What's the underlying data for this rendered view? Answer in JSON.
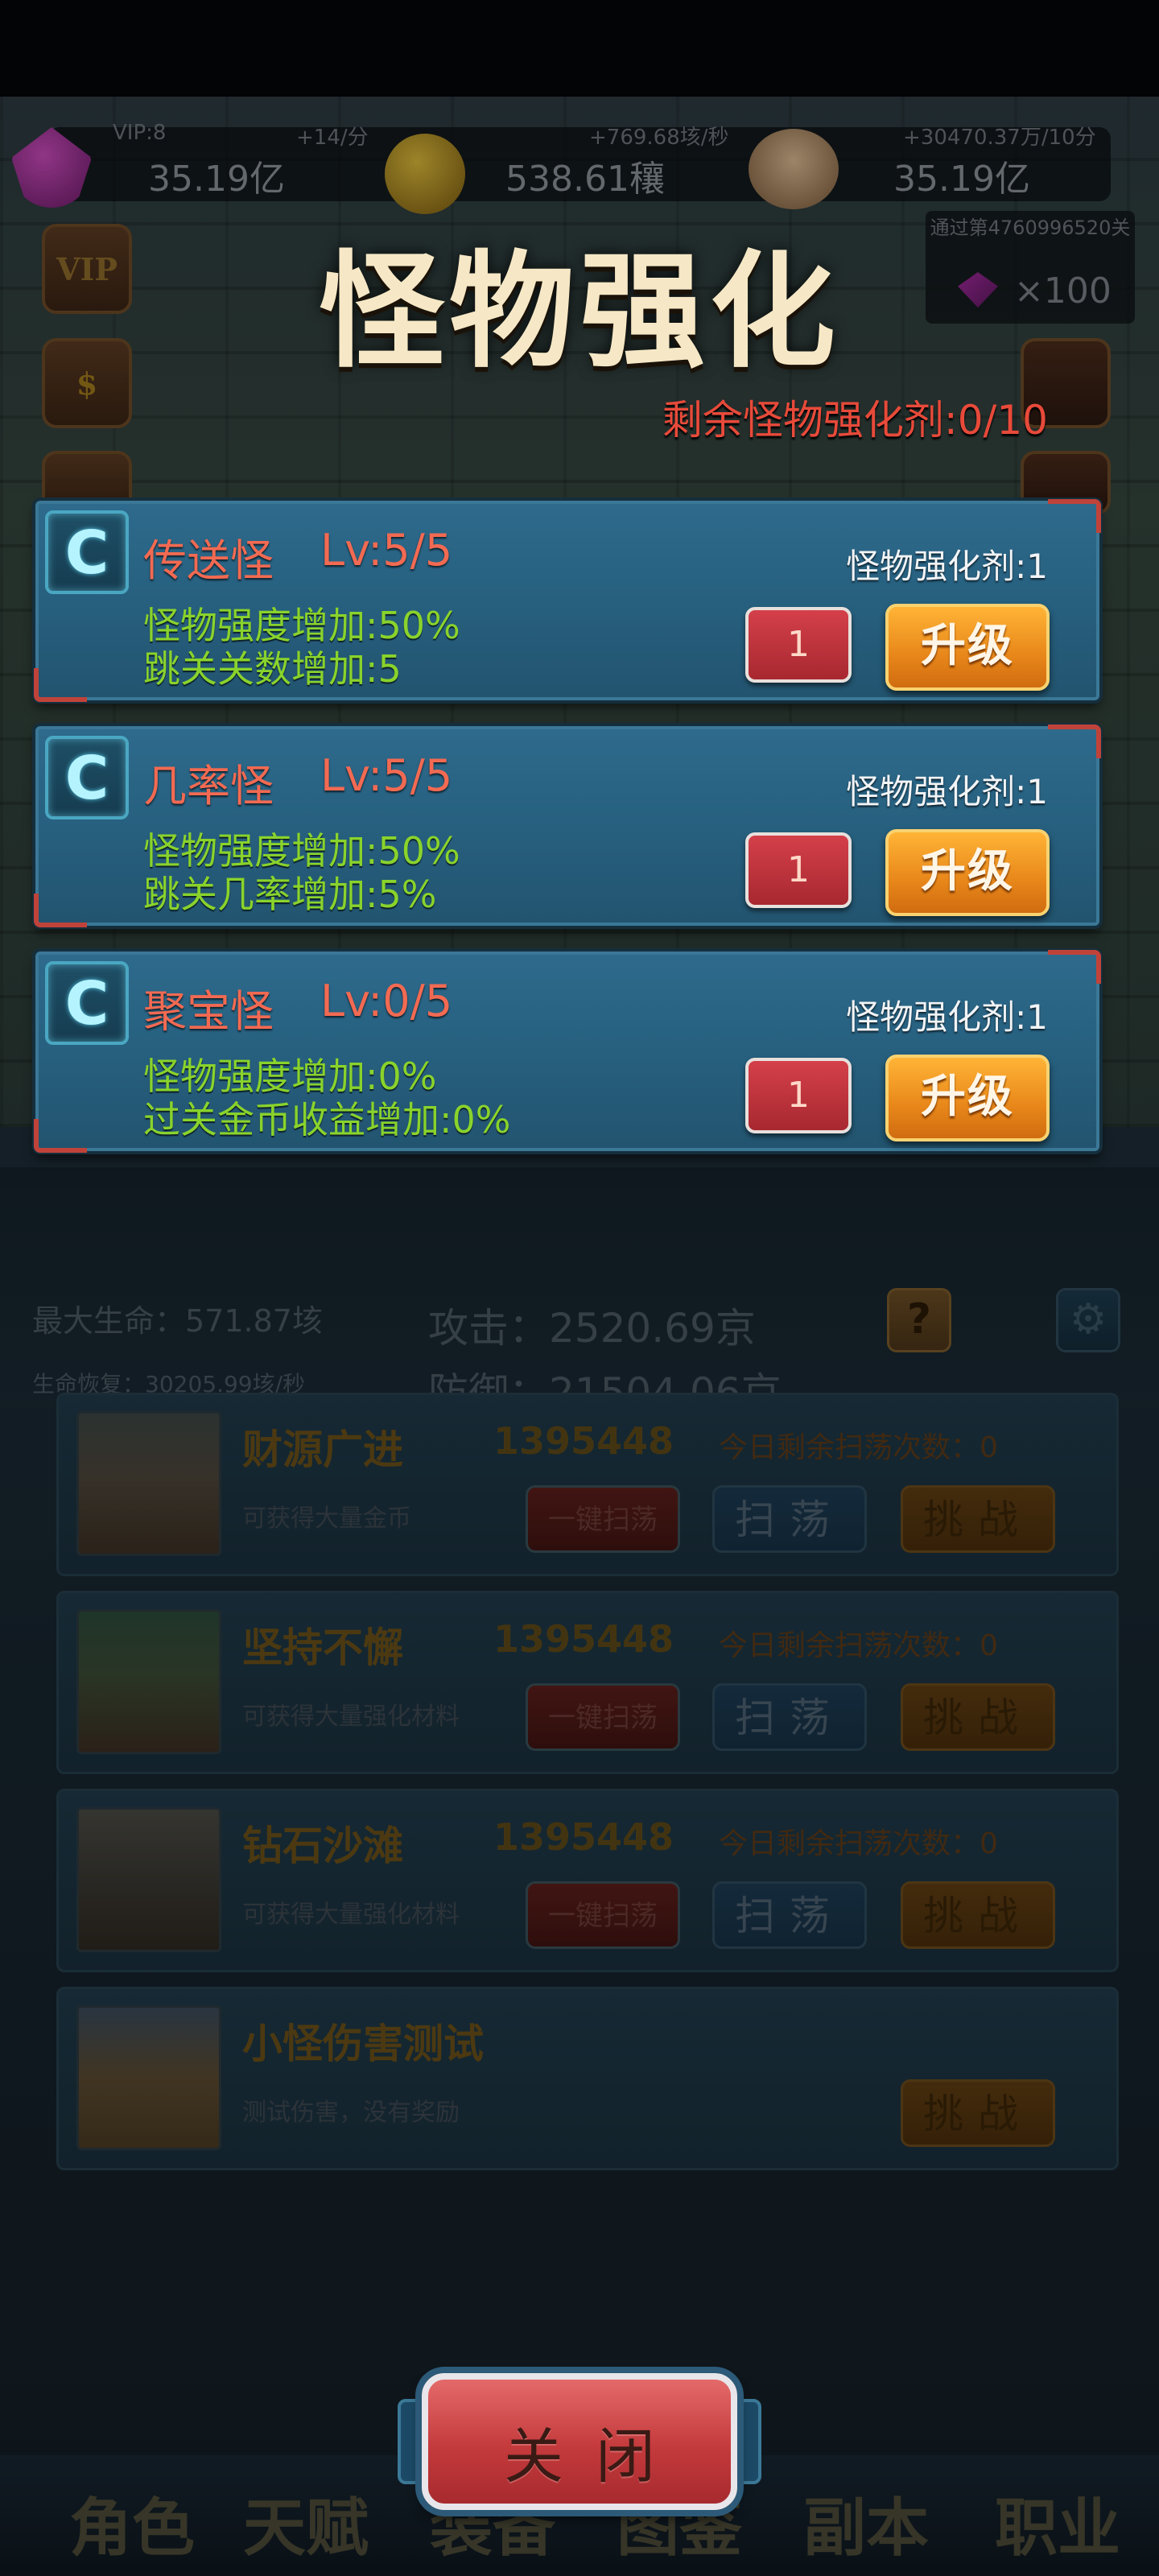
{
  "header": {
    "vip_level": "VIP:8",
    "gem_rate": "+14/分",
    "gem_amount": "35.19亿",
    "coin_rate": "+769.68垓/秒",
    "coin_amount": "538.61穰",
    "skull_rate": "+30470.37万/10分",
    "skull_amount": "35.19亿"
  },
  "side_buttons": {
    "vip_label": "VIP"
  },
  "pass_reward": {
    "text": "通过第4760996520关",
    "count": "×100"
  },
  "popup": {
    "title": "怪物强化",
    "remaining": "剩余怪物强化剂:0/10",
    "cards": [
      {
        "name": "传送怪",
        "level": "Lv:5/5",
        "cost": "怪物强化剂:1",
        "effect1": "怪物强度增加:50%",
        "effect2": "跳关关数增加:5",
        "qty": "1",
        "upgrade": "升级"
      },
      {
        "name": "几率怪",
        "level": "Lv:5/5",
        "cost": "怪物强化剂:1",
        "effect1": "怪物强度增加:50%",
        "effect2": "跳关几率增加:5%",
        "qty": "1",
        "upgrade": "升级"
      },
      {
        "name": "聚宝怪",
        "level": "Lv:0/5",
        "cost": "怪物强化剂:1",
        "effect1": "怪物强度增加:0%",
        "effect2": "过关金币收益增加:0%",
        "qty": "1",
        "upgrade": "升级"
      }
    ],
    "close": "关闭"
  },
  "stats": {
    "max_hp": "最大生命：571.87垓",
    "regen": "生命恢复：30205.99垓/秒",
    "attack": "攻击：2520.69京",
    "defense": "防御：21504.06京",
    "help": "?"
  },
  "dungeons": [
    {
      "name": "财源广进",
      "score": "1395448",
      "remain": "今日剩余扫荡次数：0",
      "desc": "可获得大量金币",
      "quick": "一键扫荡",
      "sweep": "扫荡",
      "challenge": "挑战"
    },
    {
      "name": "坚持不懈",
      "score": "1395448",
      "remain": "今日剩余扫荡次数：0",
      "desc": "可获得大量强化材料",
      "quick": "一键扫荡",
      "sweep": "扫荡",
      "challenge": "挑战"
    },
    {
      "name": "钻石沙滩",
      "score": "1395448",
      "remain": "今日剩余扫荡次数：0",
      "desc": "可获得大量强化材料",
      "quick": "一键扫荡",
      "sweep": "扫荡",
      "challenge": "挑战"
    },
    {
      "name": "小怪伤害测试",
      "desc": "测试伤害，没有奖励",
      "challenge": "挑战"
    }
  ],
  "nav": [
    "角色",
    "天赋",
    "装备",
    "图鉴",
    "副本",
    "职业"
  ],
  "colors": {
    "accent_orange": "#e8871a",
    "title_cream": "#f6e8c6",
    "remaining_red": "#e84a3a",
    "effect_green": "#89d32c",
    "card_blue": "#2e6a8c"
  }
}
